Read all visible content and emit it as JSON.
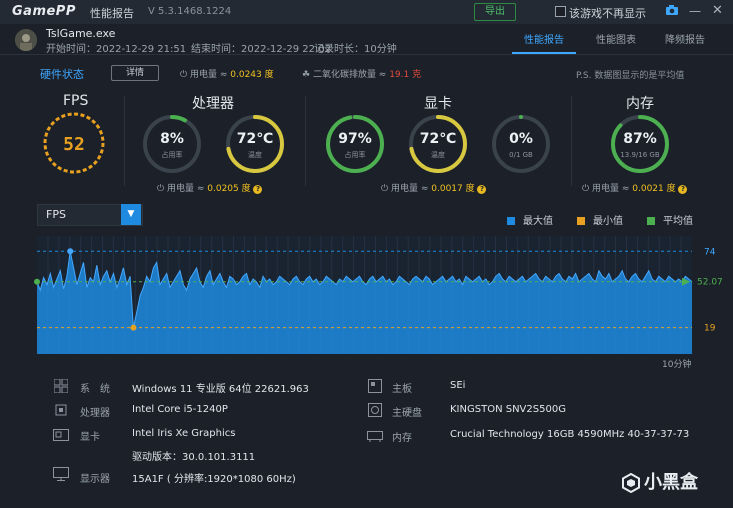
{
  "titlebar": {
    "logo": "GamePP",
    "title": "性能报告",
    "version": "V 5.3.1468.1224",
    "export_label": "导出",
    "checkbox_label": "该游戏不再显示"
  },
  "game": {
    "name": "TslGame.exe",
    "start": "开始时间：2022-12-29 21:51",
    "end": "结束时间：2022-12-29 22:02",
    "duration": "记录时长：10分钟"
  },
  "tabs": [
    {
      "label": "性能报告",
      "active": true
    },
    {
      "label": "性能图表",
      "active": false
    },
    {
      "label": "降频报告",
      "active": false
    }
  ],
  "status": {
    "title": "硬件状态",
    "detail_button": "详情",
    "power_label": "用电量 ≈ ",
    "power_value": "0.0243 度",
    "co2_label": "二氧化碳排放量 ≈ ",
    "co2_value": "19.1 克",
    "note": "P.S. 数据图显示的是平均值"
  },
  "fps": {
    "title": "FPS",
    "value": "52"
  },
  "cpu": {
    "title": "处理器",
    "usage": "8%",
    "usage_label": "占用率",
    "usage_frac": 0.08,
    "temp": "72℃",
    "temp_label": "温度",
    "temp_frac": 0.72,
    "power_label": "用电量 ≈ ",
    "power_value": "0.0205 度"
  },
  "gpu": {
    "title": "显卡",
    "usage": "97%",
    "usage_label": "占用率",
    "usage_frac": 0.97,
    "temp": "72℃",
    "temp_label": "温度",
    "temp_frac": 0.72,
    "vram": "0%",
    "vram_label": "0/1 GB",
    "vram_frac": 0.0,
    "power_label": "用电量 ≈ ",
    "power_value": "0.0017 度"
  },
  "memory": {
    "title": "内存",
    "usage": "87%",
    "usage_label": "13.9/16 GB",
    "usage_frac": 0.87,
    "power_label": "用电量 ≈ ",
    "power_value": "0.0021 度"
  },
  "chart_select": {
    "value": "FPS"
  },
  "legend": [
    {
      "label": "最大值",
      "color": "#1f8be0"
    },
    {
      "label": "最小值",
      "color": "#e8a020"
    },
    {
      "label": "平均值",
      "color": "#4caf50"
    }
  ],
  "chart_data": {
    "type": "area",
    "series_color": "#1f8be0",
    "max": 74,
    "min": 19,
    "avg": 52.07,
    "max_label": "74",
    "min_label": "19",
    "avg_label": "52.07",
    "end_label": "10分钟",
    "ylim": [
      0,
      85
    ],
    "values": [
      52,
      46,
      55,
      50,
      58,
      48,
      54,
      60,
      47,
      56,
      74,
      62,
      50,
      58,
      66,
      48,
      55,
      52,
      64,
      50,
      56,
      60,
      52,
      58,
      48,
      54,
      62,
      50,
      56,
      19,
      30,
      42,
      48,
      56,
      52,
      62,
      66,
      50,
      54,
      58,
      48,
      52,
      56,
      60,
      50,
      46,
      54,
      58,
      62,
      52,
      48,
      56,
      60,
      50,
      54,
      58,
      52,
      48,
      56,
      54,
      50,
      52,
      56,
      58,
      50,
      54,
      52,
      48,
      56,
      52,
      54,
      50,
      52,
      56,
      54,
      52,
      50,
      54,
      56,
      52,
      50,
      54,
      56,
      52,
      54,
      50,
      52,
      56,
      54,
      52,
      50,
      54,
      52,
      56,
      54,
      52,
      54,
      56,
      52,
      50,
      54,
      56,
      52,
      54,
      56,
      52,
      54,
      50,
      52,
      56,
      54,
      52,
      50,
      54,
      56,
      54,
      52,
      56,
      54,
      50,
      52,
      54,
      56,
      52,
      54,
      56,
      52,
      54,
      50,
      56,
      54,
      52,
      54,
      56,
      52,
      54,
      50,
      52,
      56,
      58,
      54,
      52,
      56,
      54,
      52,
      54,
      56,
      52,
      54,
      56,
      58,
      54,
      52,
      56,
      54,
      52,
      56,
      58,
      54,
      52,
      56,
      54,
      58,
      52,
      54,
      56,
      58,
      54,
      52,
      60,
      56,
      54,
      58,
      52,
      54,
      56,
      60,
      54,
      52,
      56,
      58,
      54,
      52,
      56,
      60,
      54,
      52,
      56,
      54,
      52,
      56,
      54,
      52,
      54,
      52,
      56,
      54,
      52
    ]
  },
  "sysinfo": {
    "os_label": "系　统",
    "os": "Windows 11 专业版 64位 22621.963",
    "cpu_label": "处理器",
    "cpu": "Intel Core i5-1240P",
    "gpu_label": "显卡",
    "gpu": "Intel Iris Xe Graphics",
    "driver": "驱动版本：30.0.101.3111",
    "display_label": "显示器",
    "display": "15A1F ( 分辨率:1920*1080 60Hz)",
    "board_label": "主板",
    "board": "SEi",
    "disk_label": "主硬盘",
    "disk": "KINGSTON SNV2S500G",
    "mem_label": "内存",
    "mem": "Crucial Technology 16GB 4590MHz 40-37-37-73"
  },
  "watermark": "小黑盒"
}
